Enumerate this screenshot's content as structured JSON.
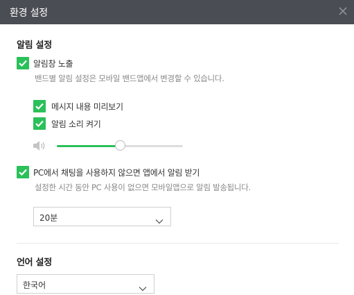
{
  "window": {
    "title": "환경 설정",
    "close_symbol": "×"
  },
  "notification": {
    "section_title": "알림 설정",
    "notification_bar": {
      "label": "알림창 노출",
      "checked": true,
      "description": "밴드별 알림 설정은 모바일 밴드앱에서 변경할 수 있습니다."
    },
    "message_preview": {
      "label": "메시지 내용 미리보기",
      "checked": true
    },
    "sound": {
      "label": "알림 소리 켜기",
      "checked": true
    },
    "volume": {
      "icon": "speaker-icon",
      "level": 0.5
    },
    "pc_inactive": {
      "label": "PC에서 채팅을 사용하지 않으면 앱에서 알림 받기",
      "checked": true,
      "description": "설정한 시간 동안 PC 사용이 없으면 모바일앱으로 알림 발송됩니다."
    },
    "time_select": {
      "value": "20분"
    }
  },
  "language": {
    "section_title": "언어 설정",
    "select": {
      "value": "한국어"
    }
  },
  "colors": {
    "accent": "#2ac05a",
    "titlebar": "#4a4d53"
  }
}
